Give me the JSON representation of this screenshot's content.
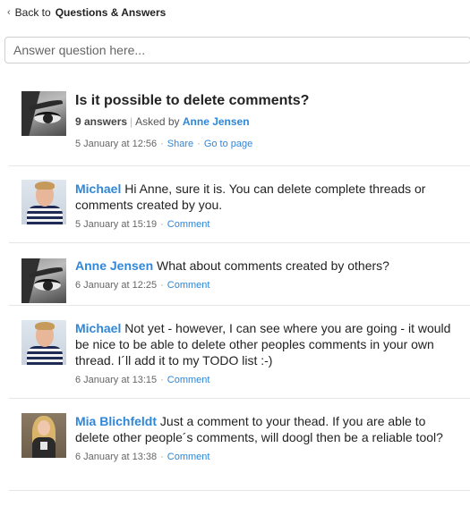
{
  "back": {
    "prefix": "Back to",
    "section": "Questions & Answers"
  },
  "answer_input": {
    "placeholder": "Answer question here...",
    "value": ""
  },
  "question": {
    "title": "Is it possible to delete comments?",
    "answers_count": "9 answers",
    "asked_by_label": "Asked by",
    "asked_by": "Anne Jensen",
    "date": "5 January at 12:56",
    "share_label": "Share",
    "goto_label": "Go to page",
    "avatar_icon": "eye-photo-avatar"
  },
  "comments": [
    {
      "author": "Michael",
      "text": "Hi Anne, sure it is. You can delete complete threads or comments created by you.",
      "date": "5 January at 15:19",
      "action": "Comment",
      "avatar_icon": "michael-photo-avatar"
    },
    {
      "author": "Anne Jensen",
      "text": "What about comments created by others?",
      "date": "6 January at 12:25",
      "action": "Comment",
      "avatar_icon": "eye-photo-avatar"
    },
    {
      "author": "Michael",
      "text": "Not yet - however, I can see where you are going - it would be nice to be able to delete other peoples comments in your own thread. I´ll add it to my TODO list :-)",
      "date": "6 January at 13:15",
      "action": "Comment",
      "avatar_icon": "michael-photo-avatar"
    },
    {
      "author": "Mia Blichfeldt",
      "text": "Just a comment to your thead. If you are able to delete other people´s comments, will doogl then be a reliable tool?",
      "date": "6 January at 13:38",
      "action": "Comment",
      "avatar_icon": "mia-photo-avatar"
    }
  ],
  "colors": {
    "link": "#2f87d8",
    "divider": "#e6e6e6",
    "meta": "#666666"
  }
}
